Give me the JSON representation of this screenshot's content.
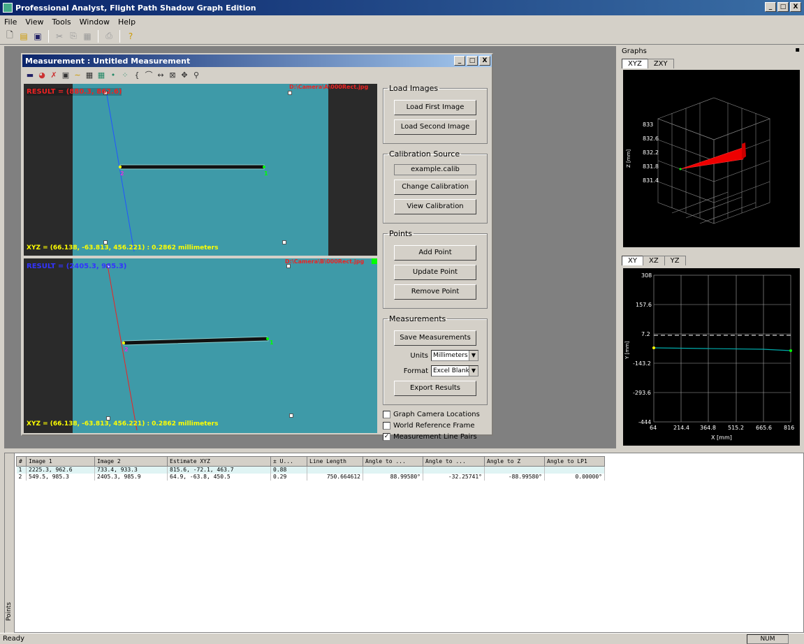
{
  "app": {
    "title": "Professional Analyst, Flight Path Shadow Graph Edition",
    "window_buttons": [
      "_",
      "□",
      "X"
    ]
  },
  "menu": [
    "File",
    "View",
    "Tools",
    "Window",
    "Help"
  ],
  "mdi": {
    "title": "Measurement : Untitled Measurement",
    "top_image": {
      "label_left": "RESULT = (880.3, 862.6)",
      "label_right": "D:\\Camera\\A\\000Rect.jpg",
      "xyz": "XYZ = (66.138, -63.813, 456.221)  : 0.2862 millimeters",
      "pt_labels": [
        "2",
        "1"
      ]
    },
    "bottom_image": {
      "label_left": "RESULT = (2405.3, 985.3)",
      "label_right": "D:\\Camera\\B\\000Rect.jpg",
      "xyz": "XYZ = (66.138, -63.813, 456.221)  : 0.2862 millimeters",
      "pt_labels": [
        "2",
        "1"
      ]
    }
  },
  "panel": {
    "load_images": {
      "legend": "Load Images",
      "first": "Load First Image",
      "second": "Load Second Image"
    },
    "calibration": {
      "legend": "Calibration Source",
      "file": "example.calib",
      "change": "Change Calibration",
      "view": "View Calibration"
    },
    "points": {
      "legend": "Points",
      "add": "Add Point",
      "update": "Update Point",
      "remove": "Remove Point"
    },
    "measurements": {
      "legend": "Measurements",
      "save": "Save Measurements",
      "units_label": "Units",
      "units_value": "Millimeters",
      "format_label": "Format",
      "format_value": "Excel Blank",
      "export": "Export Results"
    },
    "checks": [
      {
        "label": "Graph Camera Locations",
        "checked": false
      },
      {
        "label": "World Reference Frame",
        "checked": false
      },
      {
        "label": "Measurement Line Pairs",
        "checked": true
      }
    ]
  },
  "graphs": {
    "title": "Graphs",
    "tabs_top": [
      "XYZ",
      "ZXY"
    ],
    "tabs_bottom": [
      "XY",
      "XZ",
      "YZ"
    ],
    "xyz_ticks": [
      "833",
      "832.6",
      "832.2",
      "831.8",
      "831.4"
    ],
    "xyz_axis": "Z [mm]",
    "xy": {
      "yticks": [
        "308",
        "157.6",
        "7.2",
        "-143.2",
        "-293.6",
        "-444"
      ],
      "xticks": [
        "64",
        "214.4",
        "364.8",
        "515.2",
        "665.6",
        "816"
      ],
      "xlabel": "X [mm]",
      "ylabel": "Y [mm]"
    }
  },
  "table": {
    "columns": [
      "#",
      "Image 1",
      "Image 2",
      "Estimate XYZ",
      "± U...",
      "Line Length",
      "Angle to ...",
      "Angle to ...",
      "Angle to Z",
      "Angle to LP1"
    ],
    "rows": [
      [
        "1",
        "2225.3,    962.6",
        "733.4,    933.3",
        "815.6, -72.1,  463.7",
        "0.88",
        "",
        "",
        "",
        "",
        ""
      ],
      [
        "2",
        "549.5,   985.3",
        "2405.3,   985.9",
        "64.9, -63.8,  450.5",
        "0.29",
        "750.664612",
        "88.99580°",
        "-32.25741°",
        "-88.99580°",
        "0.00000°"
      ]
    ],
    "side_label": "Points"
  },
  "status": {
    "left": "Ready",
    "num": "NUM"
  }
}
